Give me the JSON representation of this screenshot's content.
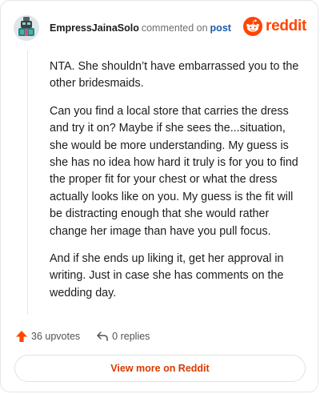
{
  "header": {
    "username": "EmpressJainaSolo",
    "action": "commented on",
    "post_link": "post",
    "brand": "reddit"
  },
  "comment": {
    "paragraphs": [
      "NTA. She shouldn’t have embarrassed you to the other bridesmaids.",
      "Can you find a local store that carries the dress and try it on? Maybe if she sees the...situation, she would be more understanding. My guess is she has no idea how hard it truly is for you to find the proper fit for your chest or what the dress actually looks like on you. My guess is the fit will be distracting enough that she would rather change her image than have you pull focus.",
      "And if she ends up liking it, get her approval in writing. Just in case she has comments on the wedding day."
    ]
  },
  "footer": {
    "upvotes": "36 upvotes",
    "replies": "0 replies"
  },
  "cta": {
    "label": "View more on Reddit"
  },
  "colors": {
    "brand": "#ff4500",
    "link": "#1c5ab0",
    "cta_text": "#d93a00"
  },
  "icons": {
    "upvote": "upvote-arrow-icon",
    "reply": "reply-arrow-icon",
    "brand": "reddit-snoo-icon"
  }
}
